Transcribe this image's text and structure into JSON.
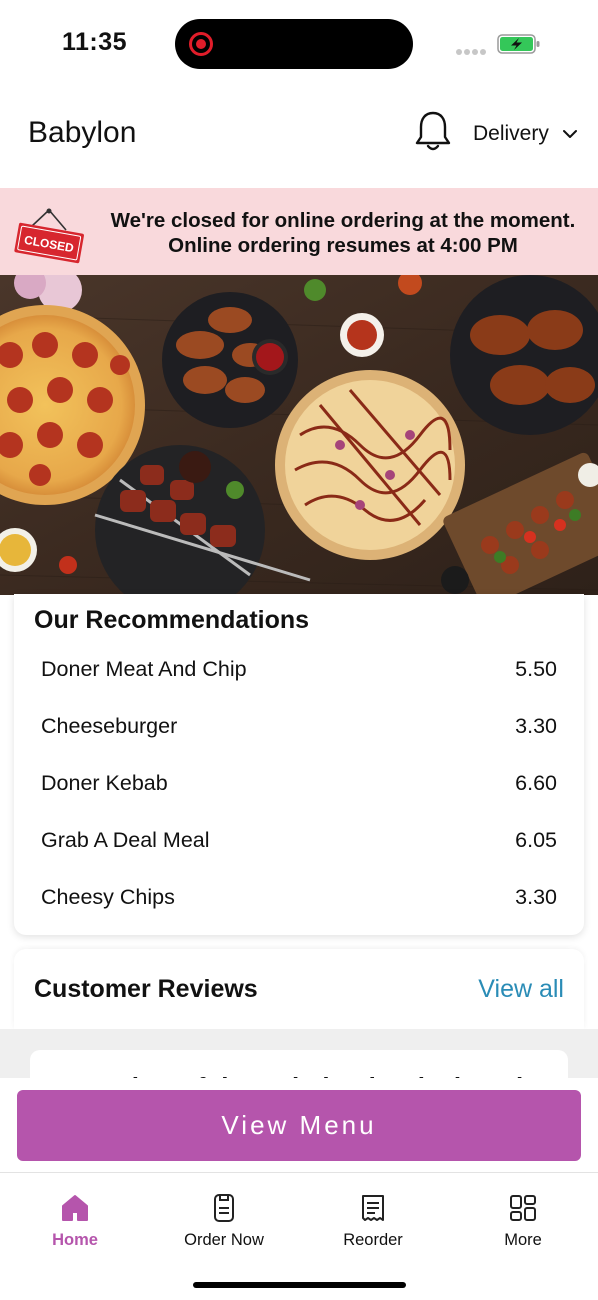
{
  "status_bar": {
    "time": "11:35",
    "icons": [
      "screen-record-icon",
      "signal-dots-icon",
      "battery-charging-icon"
    ]
  },
  "header": {
    "title": "Babylon",
    "bell_icon": "bell-icon",
    "mode_label": "Delivery",
    "mode_icon": "chevron-down-icon"
  },
  "closed_banner": {
    "sign_text": "CLOSED",
    "line1": "We're closed for online ordering at the moment.",
    "line2": "Online ordering resumes at 4:00 PM",
    "background": "#f9d9dc"
  },
  "hero": {
    "description_icon": "food-spread-image"
  },
  "recommendations": {
    "title": "Our Recommendations",
    "items": [
      {
        "name": "Doner Meat And Chip",
        "price": "5.50"
      },
      {
        "name": "Cheeseburger",
        "price": "3.30"
      },
      {
        "name": "Doner Kebab",
        "price": "6.60"
      },
      {
        "name": "Grab A Deal Meal",
        "price": "6.05"
      },
      {
        "name": "Cheesy Chips",
        "price": "3.30"
      }
    ]
  },
  "reviews": {
    "title": "Customer Reviews",
    "view_all": "View all",
    "preview_text": "Review of the Babylon in Blackpool",
    "accent": "#2a8cb6"
  },
  "cta": {
    "label": "View Menu",
    "color": "#b555ac"
  },
  "bottom_nav": {
    "items": [
      {
        "label": "Home",
        "icon": "home-icon",
        "active": true
      },
      {
        "label": "Order Now",
        "icon": "order-icon",
        "active": false
      },
      {
        "label": "Reorder",
        "icon": "receipt-icon",
        "active": false
      },
      {
        "label": "More",
        "icon": "grid-icon",
        "active": false
      }
    ],
    "active_color": "#b555ac"
  }
}
